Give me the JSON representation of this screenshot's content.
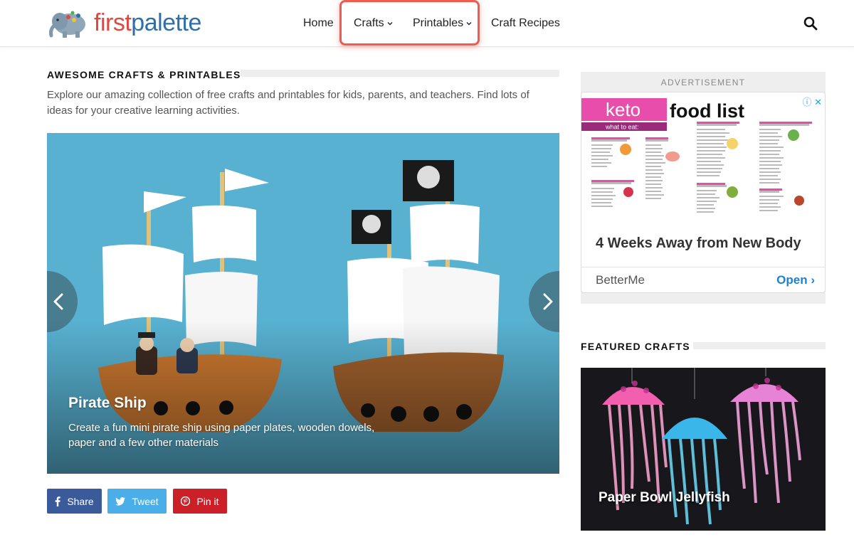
{
  "brand": {
    "first": "first",
    "palette": "palette"
  },
  "nav": {
    "home": "Home",
    "crafts": "Crafts",
    "printables": "Printables",
    "craft_recipes": "Craft Recipes"
  },
  "main": {
    "section_title": "AWESOME CRAFTS & PRINTABLES",
    "intro": "Explore our amazing collection of free crafts and printables for kids, parents, and teachers. Find lots of ideas for your creative learning activities.",
    "slide": {
      "title": "Pirate Ship",
      "description": "Create a fun mini pirate ship using paper plates, wooden dowels, paper and a few other materials"
    },
    "share": {
      "facebook": "Share",
      "twitter": "Tweet",
      "pinterest": "Pin it"
    }
  },
  "sidebar": {
    "ad": {
      "label": "ADVERTISEMENT",
      "image_title_a": "keto",
      "image_title_b": "food list",
      "image_subtitle": "what to eat:",
      "headline": "4 Weeks Away from New Body",
      "brand": "BetterMe",
      "cta": "Open"
    },
    "featured": {
      "section_title": "FEATURED CRAFTS",
      "title": "Paper Bowl Jellyfish"
    }
  },
  "colors": {
    "highlight": "#ef5b4c",
    "facebook": "#3b5a9a",
    "twitter": "#4aaee8",
    "pinterest": "#cb2027",
    "logo_red": "#e0483e",
    "logo_blue": "#2f6fa8",
    "ad_cta": "#1a82d6"
  },
  "icons": [
    "elephant-logo-icon",
    "chevron-down-icon",
    "search-icon",
    "chevron-left-icon",
    "chevron-right-icon",
    "facebook-icon",
    "twitter-icon",
    "pinterest-icon",
    "adchoices-icon",
    "close-icon"
  ]
}
